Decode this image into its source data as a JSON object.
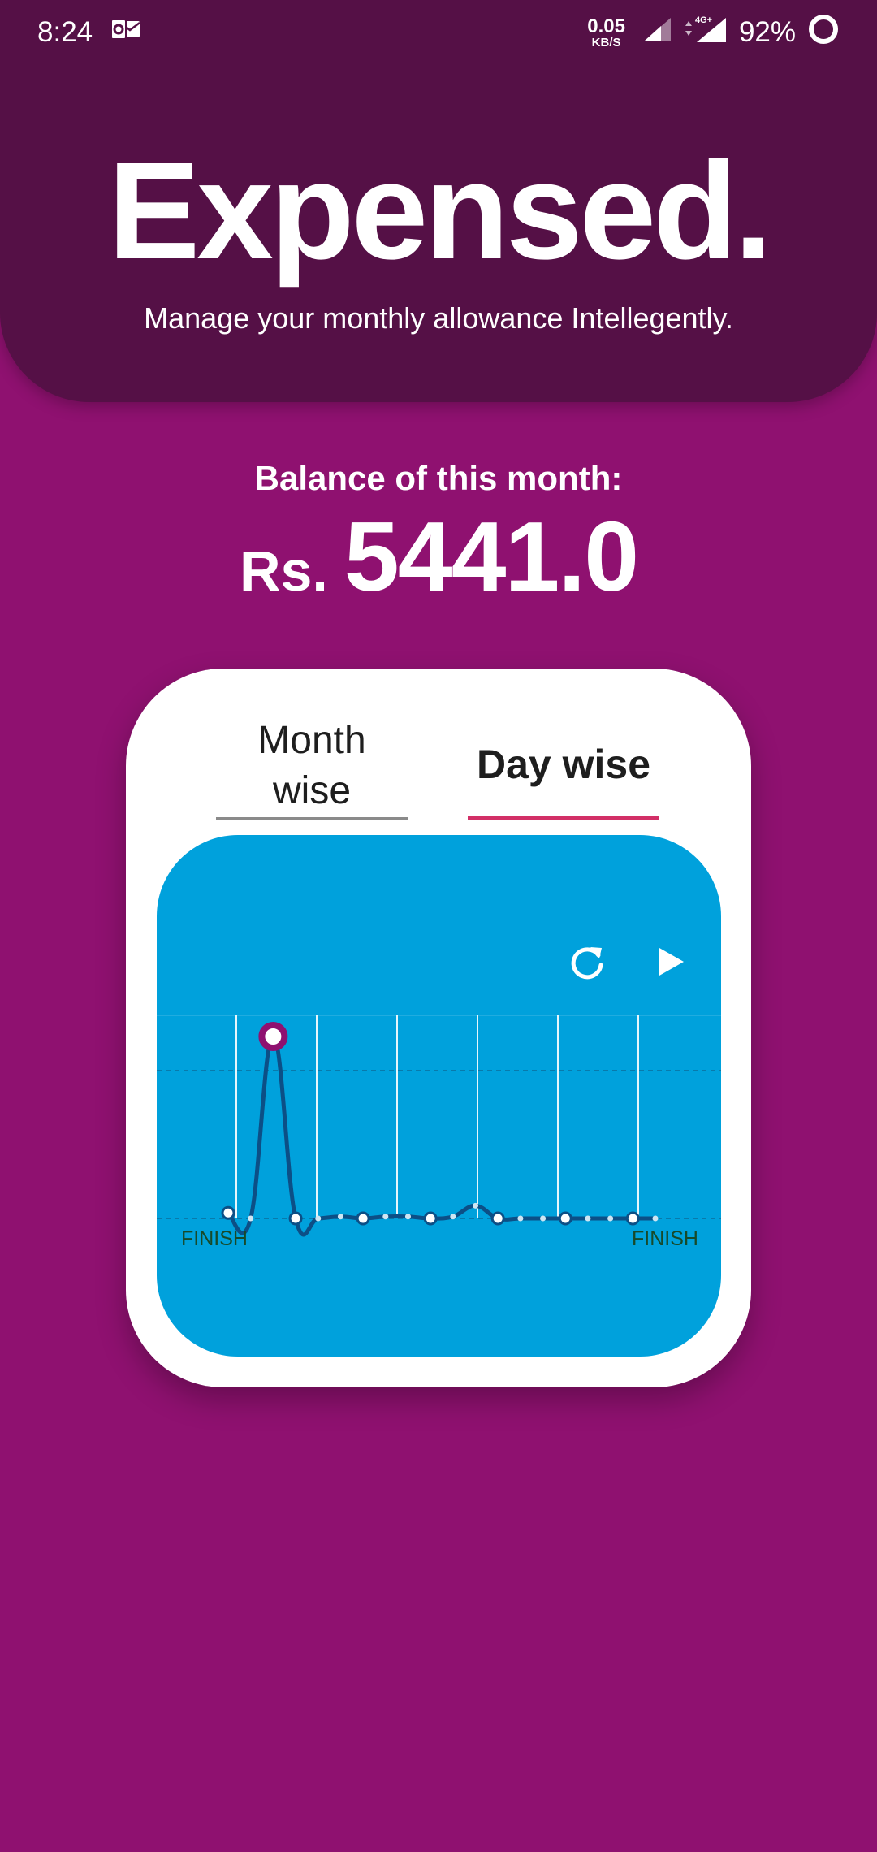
{
  "status": {
    "time": "8:24",
    "net_speed_value": "0.05",
    "net_speed_unit": "KB/S",
    "network_type": "4G+",
    "battery": "92%"
  },
  "header": {
    "title": "Expensed.",
    "subtitle": "Manage your monthly allowance Intellegently."
  },
  "balance": {
    "label": "Balance of this month:",
    "currency": "Rs.",
    "amount": "5441.0"
  },
  "tabs": [
    {
      "label": "Month\nwise",
      "selected": false
    },
    {
      "label": "Day wise",
      "selected": true
    }
  ],
  "chart": {
    "icons": [
      "reload-icon",
      "play-icon"
    ],
    "finish_left": "FINISH",
    "finish_right": "FINISH",
    "colors": {
      "background": "#00a1dc",
      "line": "#0c4f86",
      "highlight": "#8f1170"
    }
  },
  "chart_data": {
    "type": "line",
    "series": [
      {
        "values": [
          3,
          0,
          100,
          0,
          0,
          1,
          0,
          1,
          1,
          0,
          1,
          7,
          0,
          0,
          0,
          0,
          0,
          0,
          0,
          0
        ]
      }
    ],
    "highlighted_index": 2
  }
}
